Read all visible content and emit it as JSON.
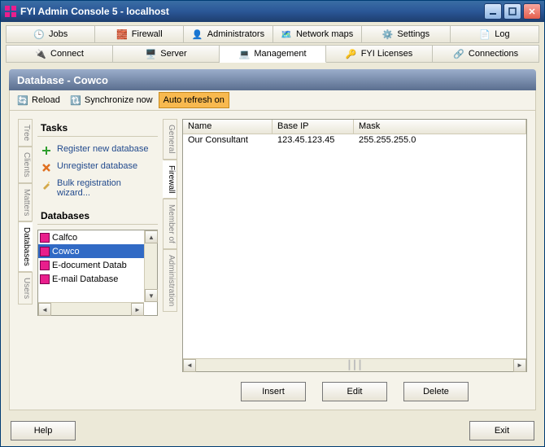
{
  "window": {
    "title": "FYI Admin Console 5 - localhost"
  },
  "topTabs1": {
    "jobs": "Jobs",
    "firewall": "Firewall",
    "administrators": "Administrators",
    "networkMaps": "Network maps",
    "settings": "Settings",
    "log": "Log"
  },
  "topTabs2": {
    "connect": "Connect",
    "server": "Server",
    "management": "Management",
    "fyiLicenses": "FYI Licenses",
    "connections": "Connections"
  },
  "panel": {
    "title": "Database - Cowco"
  },
  "subToolbar": {
    "reload": "Reload",
    "sync": "Synchronize now",
    "auto": "Auto refresh on"
  },
  "leftTabs": {
    "tree": "Tree",
    "clients": "Clients",
    "matters": "Matters",
    "databases": "Databases",
    "users": "Users"
  },
  "rightTabs": {
    "general": "General",
    "firewall": "Firewall",
    "memberOf": "Member of",
    "administration": "Administration"
  },
  "tasks": {
    "title": "Tasks",
    "register": "Register new database",
    "unregister": "Unregister database",
    "bulk": "Bulk registration wizard..."
  },
  "databases": {
    "title": "Databases",
    "items": [
      "Calfco",
      "Cowco",
      "E-document Datab",
      "E-mail Database"
    ],
    "selectedIndex": 1
  },
  "grid": {
    "headers": {
      "name": "Name",
      "baseip": "Base IP",
      "mask": "Mask"
    },
    "rows": [
      {
        "name": "Our Consultant",
        "baseip": "123.45.123.45",
        "mask": "255.255.255.0"
      }
    ]
  },
  "buttons": {
    "insert": "Insert",
    "edit": "Edit",
    "delete": "Delete"
  },
  "footer": {
    "help": "Help",
    "exit": "Exit"
  }
}
